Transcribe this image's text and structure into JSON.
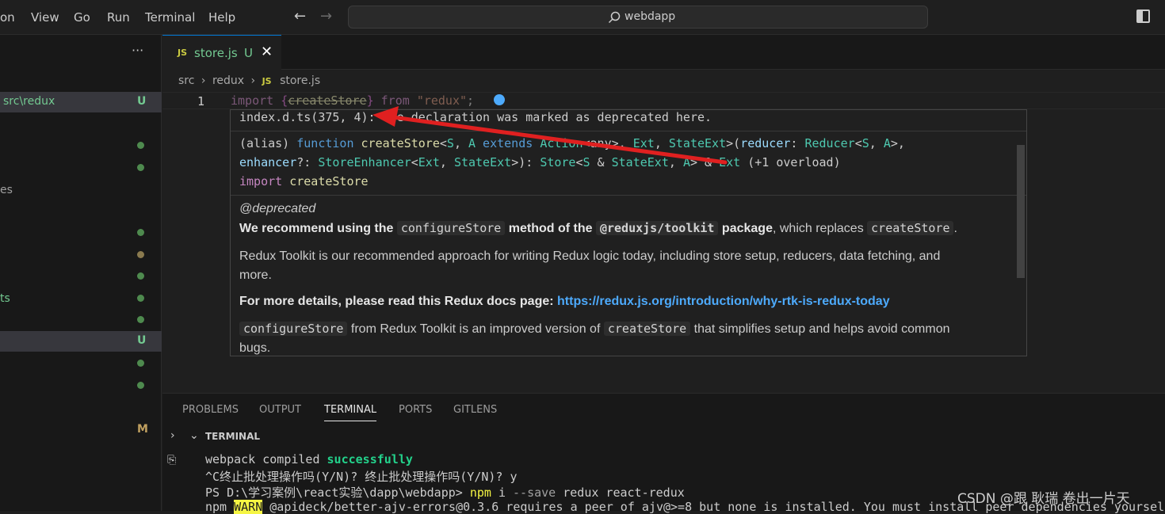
{
  "menu": {
    "items": [
      "on",
      "View",
      "Go",
      "Run",
      "Terminal",
      "Help"
    ]
  },
  "nav": {
    "back": "←",
    "forward": "→"
  },
  "search": {
    "text": "webdapp"
  },
  "sidebar": {
    "more": "···",
    "selected_folder": "src\\redux",
    "selected_badge": "U",
    "rows": [
      {
        "label": "",
        "badge": ""
      },
      {
        "label": "es",
        "badge": ""
      },
      {
        "label": "ts",
        "badge": ""
      }
    ],
    "file_badge": "U",
    "modified_badge": "M"
  },
  "tab": {
    "icon": "JS",
    "name": "store.js",
    "badge": "U",
    "close": "✕"
  },
  "breadcrumb": {
    "parts": [
      "src",
      "redux",
      "store.js"
    ],
    "file_icon": "JS"
  },
  "editor": {
    "line_number": "1",
    "code": {
      "kw": "import",
      "open": "{",
      "name": "createStore",
      "close": "}",
      "from": "from",
      "module": "\"redux\"",
      "semi": ";"
    }
  },
  "hover": {
    "declaration": {
      "ref": "index.d.ts(375, 4):",
      "text": " The declaration was marked as deprecated here."
    },
    "signature": {
      "line1": [
        "(alias) ",
        "function ",
        "createStore",
        "<",
        "S",
        ", ",
        "A",
        " extends ",
        "Action",
        "<any>",
        ", ",
        "Ext",
        ", ",
        "StateExt",
        ">(",
        "reducer",
        ": ",
        "Reducer",
        "<",
        "S",
        ", ",
        "A",
        ">,"
      ],
      "line2": [
        "enhancer",
        "?: ",
        "StoreEnhancer",
        "<",
        "Ext",
        ", ",
        "StateExt",
        ">): ",
        "Store",
        "<",
        "S",
        " & ",
        "StateExt",
        ", ",
        "A",
        "> & ",
        "Ext",
        " (+1 overload)"
      ],
      "line3": [
        "import ",
        "createStore"
      ]
    },
    "doc": {
      "deprecated": "@deprecated",
      "p1_a": "We recommend using the",
      "p1_code1": "configureStore",
      "p1_b": "method of the",
      "p1_code2": "@reduxjs/toolkit",
      "p1_c": "package",
      "p1_d": ", which replaces",
      "p1_code3": "createStore",
      "p1_e": ".",
      "p2_line1": "Redux Toolkit is our recommended approach for writing Redux logic today, including store setup, reducers, data fetching, and",
      "p2_line2": "more.",
      "p3_a": "For more details, please read this Redux docs page:",
      "p3_link": "https://redux.js.org/introduction/why-rtk-is-redux-today",
      "p4_code1": "configureStore",
      "p4_a": "from Redux Toolkit is an improved version of",
      "p4_code2": "createStore",
      "p4_b": "that simplifies setup and helps avoid common",
      "p4_line2": "bugs."
    }
  },
  "panel": {
    "tabs": [
      "PROBLEMS",
      "OUTPUT",
      "TERMINAL",
      "PORTS",
      "GITLENS"
    ],
    "active_tab": "TERMINAL",
    "terminal_title": "TERMINAL",
    "lines": {
      "l1_a": "webpack compiled ",
      "l1_b": "successfully",
      "l2": "^C终止批处理操作吗(Y/N)? 终止批处理操作吗(Y/N)? y",
      "l3_a": "PS D:\\学习案例\\react实验\\dapp\\webdapp> ",
      "l3_cmd": "npm",
      "l3_b": " i ",
      "l3_opt": "--save",
      "l3_c": " redux react-redux",
      "l4_a": "npm ",
      "l4_warn": "WARN",
      "l4_b": " @apideck/better-ajv-errors@0.3.6 requires a peer of ajv@>=8 but none is installed. You must install peer dependencies yourself."
    }
  },
  "watermark": "CSDN @跟 耿瑞 卷出一片天",
  "colors": {
    "accent": "#0078d4",
    "annotation_arrow": "#e02020",
    "git_untracked": "#73c991"
  }
}
